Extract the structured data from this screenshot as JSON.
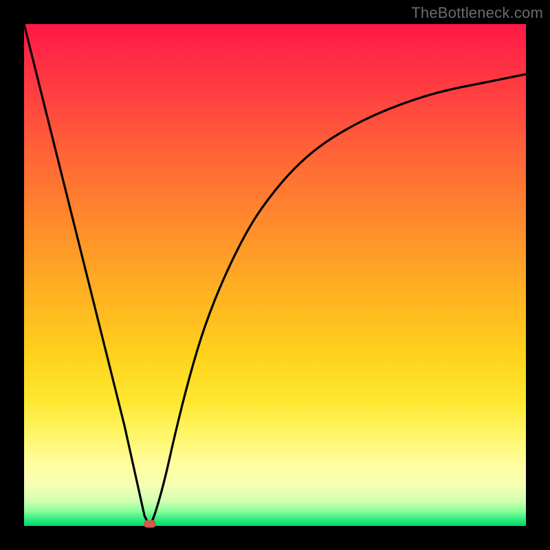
{
  "watermark": "TheBottleneck.com",
  "colors": {
    "frame": "#000000",
    "curve_stroke": "#000000",
    "marker_fill": "#cf5a4a"
  },
  "chart_data": {
    "type": "line",
    "title": "",
    "xlabel": "",
    "ylabel": "",
    "xlim": [
      0,
      100
    ],
    "ylim": [
      0,
      100
    ],
    "annotations": [],
    "series": [
      {
        "name": "bottleneck-curve",
        "x": [
          0,
          5,
          10,
          15,
          20,
          24,
          25,
          26,
          28,
          30,
          33,
          36,
          40,
          45,
          50,
          55,
          60,
          65,
          70,
          75,
          80,
          85,
          90,
          95,
          100
        ],
        "values": [
          100,
          80,
          60,
          40,
          20,
          2,
          0,
          2,
          9,
          18,
          30,
          40,
          50,
          60,
          67,
          72.5,
          76.5,
          79.5,
          82,
          84,
          85.7,
          87,
          88,
          89,
          90
        ]
      }
    ],
    "marker": {
      "x": 25,
      "y": 0
    }
  }
}
